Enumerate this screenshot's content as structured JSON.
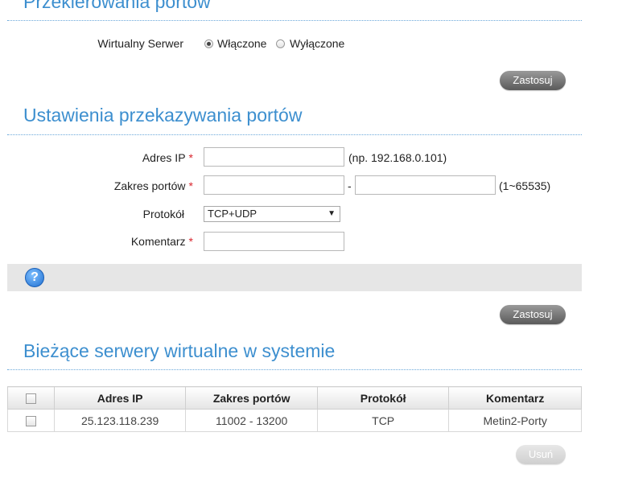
{
  "sections": {
    "port_redirect_title": "Przekierowania portów",
    "port_forward_title": "Ustawienia przekazywania portów",
    "current_servers_title": "Bieżące serwery wirtualne w systemie"
  },
  "virtual_server": {
    "label": "Wirtualny Serwer",
    "on_label": "Włączone",
    "off_label": "Wyłączone",
    "selected": "Włączone"
  },
  "buttons": {
    "apply_label": "Zastosuj",
    "delete_label": "Usuń"
  },
  "form": {
    "ip_label": "Adres IP",
    "ip_value": "",
    "ip_hint": "(np. 192.168.0.101)",
    "port_range_label": "Zakres portów",
    "port_from_value": "",
    "port_to_value": "",
    "range_separator": "-",
    "port_range_hint": "(1~65535)",
    "protocol_label": "Protokół",
    "protocol_selected": "TCP+UDP",
    "comment_label": "Komentarz",
    "comment_value": "",
    "required_mark": "*"
  },
  "table": {
    "headers": [
      "Adres IP",
      "Zakres portów",
      "Protokół",
      "Komentarz"
    ],
    "rows": [
      {
        "ip": "25.123.118.239",
        "ports": "11002 - 13200",
        "protocol": "TCP",
        "comment": "Metin2-Porty"
      }
    ]
  },
  "icons": {
    "help": "?",
    "dropdown": "▼"
  },
  "colors": {
    "title_blue": "#3d8fcf",
    "required_red": "#d9262e",
    "button_gray": "#6e6e6e"
  }
}
